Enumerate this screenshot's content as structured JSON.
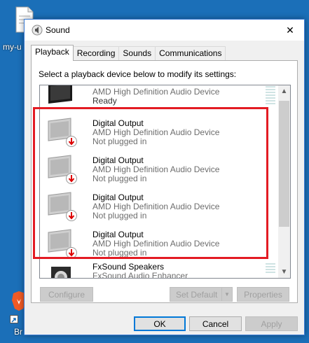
{
  "desktop": {
    "icon1_label": "my-u",
    "icon2_label": "Br"
  },
  "window": {
    "title": "Sound",
    "close_glyph": "✕"
  },
  "tabs": [
    {
      "label": "Playback",
      "active": true
    },
    {
      "label": "Recording"
    },
    {
      "label": "Sounds"
    },
    {
      "label": "Communications"
    }
  ],
  "instruction": "Select a playback device below to modify its settings:",
  "devices": [
    {
      "name": "",
      "desc": "AMD High Definition Audio Device",
      "status": "Ready"
    },
    {
      "name": "Digital Output",
      "desc": "AMD High Definition Audio Device",
      "status": "Not plugged in"
    },
    {
      "name": "Digital Output",
      "desc": "AMD High Definition Audio Device",
      "status": "Not plugged in"
    },
    {
      "name": "Digital Output",
      "desc": "AMD High Definition Audio Device",
      "status": "Not plugged in"
    },
    {
      "name": "Digital Output",
      "desc": "AMD High Definition Audio Device",
      "status": "Not plugged in"
    },
    {
      "name": "FxSound Speakers",
      "desc": "FxSound Audio Enhancer",
      "status": ""
    }
  ],
  "buttons": {
    "configure": "Configure",
    "set_default": "Set Default",
    "properties": "Properties",
    "ok": "OK",
    "cancel": "Cancel",
    "apply": "Apply"
  },
  "colors": {
    "highlight": "#e31b23",
    "accent": "#0078d7",
    "desktop": "#1b6fb8"
  }
}
